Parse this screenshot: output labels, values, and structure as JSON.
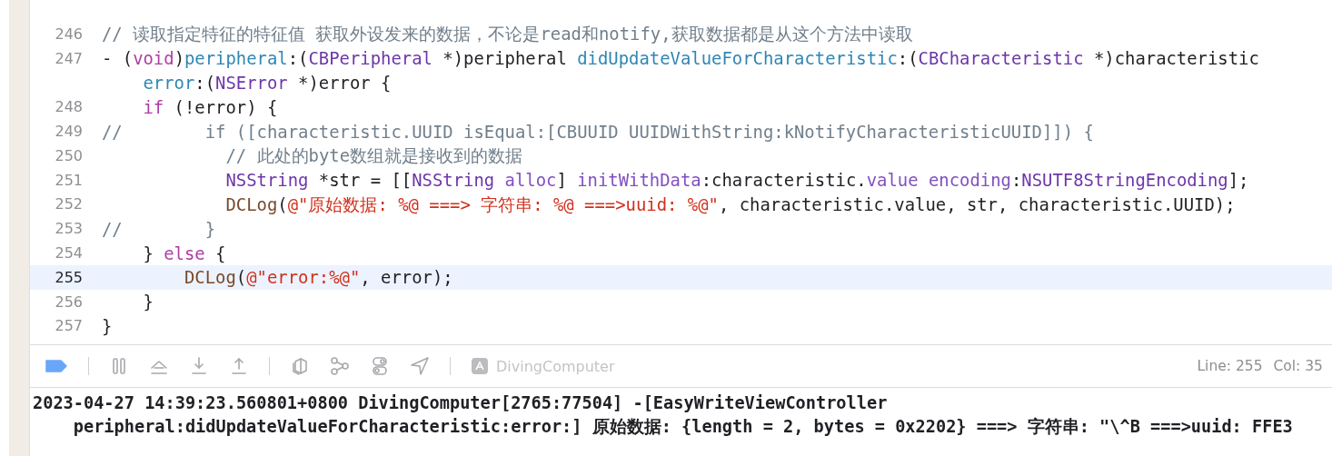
{
  "editor": {
    "lines": [
      {
        "number": "246",
        "selected": false,
        "segments": [
          {
            "kind": "comment",
            "text": "// 读取指定特征的特征值 获取外设发来的数据，不论是read和notify,获取数据都是从这个方法中读取"
          }
        ]
      },
      {
        "number": "247",
        "selected": false,
        "segments": [
          {
            "kind": "plain",
            "text": "- ("
          },
          {
            "kind": "keyword",
            "text": "void"
          },
          {
            "kind": "plain",
            "text": ")"
          },
          {
            "kind": "method",
            "text": "peripheral"
          },
          {
            "kind": "plain",
            "text": ":("
          },
          {
            "kind": "type",
            "text": "CBPeripheral"
          },
          {
            "kind": "plain",
            "text": " *)peripheral "
          },
          {
            "kind": "method",
            "text": "didUpdateValueForCharacteristic"
          },
          {
            "kind": "plain",
            "text": ":("
          },
          {
            "kind": "type",
            "text": "CBCharacteristic"
          },
          {
            "kind": "plain",
            "text": " *)characteristic"
          }
        ]
      },
      {
        "segments": [
          {
            "kind": "method",
            "text": "    error"
          },
          {
            "kind": "plain",
            "text": ":("
          },
          {
            "kind": "type",
            "text": "NSError"
          },
          {
            "kind": "plain",
            "text": " *)error {"
          }
        ]
      },
      {
        "number": "248",
        "selected": false,
        "segments": [
          {
            "kind": "keyword",
            "text": "    if"
          },
          {
            "kind": "plain",
            "text": " (!error) {"
          }
        ]
      },
      {
        "number": "249",
        "selected": false,
        "segments": [
          {
            "kind": "comment",
            "text": "//        if ([characteristic.UUID isEqual:[CBUUID UUIDWithString:kNotifyCharacteristicUUID]]) {"
          }
        ]
      },
      {
        "number": "250",
        "selected": false,
        "segments": [
          {
            "kind": "comment",
            "text": "            // 此处的byte数组就是接收到的数据"
          }
        ]
      },
      {
        "number": "251",
        "selected": false,
        "segments": [
          {
            "kind": "type",
            "text": "            NSString"
          },
          {
            "kind": "plain",
            "text": " *str = [["
          },
          {
            "kind": "type",
            "text": "NSString "
          },
          {
            "kind": "api",
            "text": "alloc"
          },
          {
            "kind": "plain",
            "text": "] "
          },
          {
            "kind": "api",
            "text": "initWithData"
          },
          {
            "kind": "plain",
            "text": ":characteristic."
          },
          {
            "kind": "api",
            "text": "value "
          },
          {
            "kind": "api",
            "text": "encoding"
          },
          {
            "kind": "plain",
            "text": ":"
          },
          {
            "kind": "type",
            "text": "NSUTF8StringEncoding"
          },
          {
            "kind": "plain",
            "text": "];"
          }
        ]
      },
      {
        "number": "252",
        "selected": false,
        "segments": [
          {
            "kind": "macro",
            "text": "            DCLog"
          },
          {
            "kind": "plain",
            "text": "("
          },
          {
            "kind": "string",
            "text": "@\"原始数据: %@ ===> 字符串: %@ ===>uuid: %@\""
          },
          {
            "kind": "plain",
            "text": ", characteristic.value, str, characteristic.UUID);"
          }
        ]
      },
      {
        "number": "253",
        "selected": false,
        "segments": [
          {
            "kind": "comment",
            "text": "//        }"
          }
        ]
      },
      {
        "number": "254",
        "selected": false,
        "segments": [
          {
            "kind": "plain",
            "text": "    } "
          },
          {
            "kind": "keyword",
            "text": "else"
          },
          {
            "kind": "plain",
            "text": " {"
          }
        ]
      },
      {
        "number": "255",
        "selected": true,
        "segments": [
          {
            "kind": "macro",
            "text": "        DCLog"
          },
          {
            "kind": "plain",
            "text": "("
          },
          {
            "kind": "string",
            "text": "@\"error:%@\""
          },
          {
            "kind": "plain",
            "text": ", error);"
          }
        ]
      },
      {
        "number": "256",
        "selected": false,
        "segments": [
          {
            "kind": "plain",
            "text": "    }"
          }
        ]
      },
      {
        "number": "257",
        "selected": false,
        "segments": [
          {
            "kind": "plain",
            "text": "}"
          }
        ]
      }
    ]
  },
  "debug_bar": {
    "breakpoints_on": true,
    "target": "DivingComputer",
    "line": "Line: 255",
    "col": "Col: 35"
  },
  "console": {
    "lines": [
      "2023-04-27 14:39:23.560801+0800 DivingComputer[2765:77504] -[EasyWriteViewController",
      "    peripheral:didUpdateValueForCharacteristic:error:] 原始数据: {length = 2, bytes = 0x2202} ===> 字符串: \"\\^B ===>uuid: FFE3"
    ]
  }
}
